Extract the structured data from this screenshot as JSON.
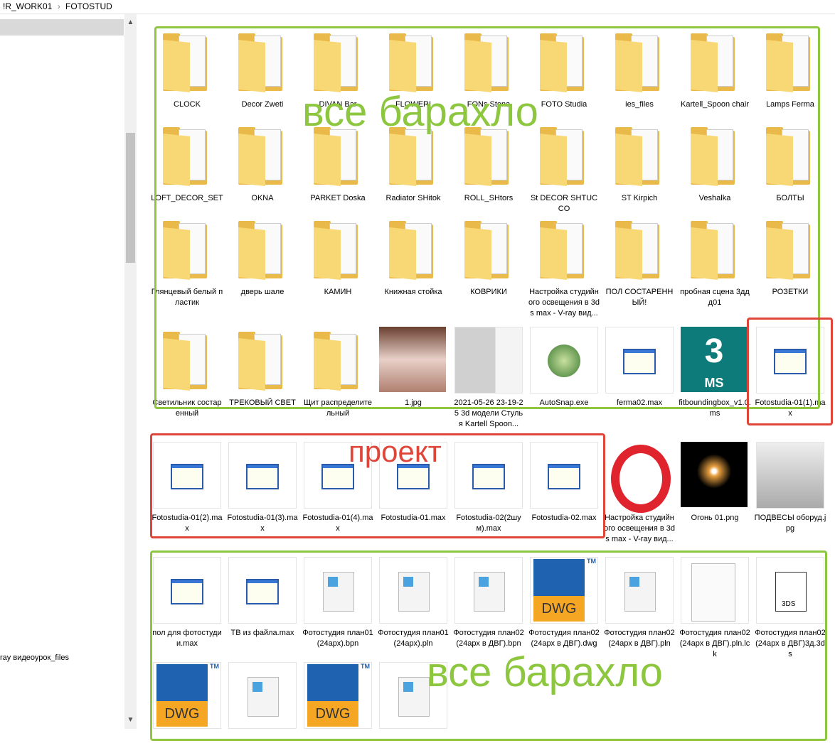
{
  "breadcrumb": [
    "!R_WORK01",
    "FOTOSTUD"
  ],
  "nav": {
    "item": "ray видеоурок_files"
  },
  "colors": {
    "green": "#8dc63f",
    "red": "#e0453a"
  },
  "annotations": {
    "junk": "все барахло",
    "project": "проект",
    "junk2": "все барахло"
  },
  "items": [
    {
      "label": "CLOCK",
      "type": "folder"
    },
    {
      "label": "Decor Zweti",
      "type": "folder"
    },
    {
      "label": "DIVAN Bar",
      "type": "folder"
    },
    {
      "label": "FLOWERI",
      "type": "folder"
    },
    {
      "label": "FONs Stena",
      "type": "folder"
    },
    {
      "label": "FOTO Studia",
      "type": "folder"
    },
    {
      "label": "ies_files",
      "type": "folder"
    },
    {
      "label": "Kartell_Spoon chair",
      "type": "folder"
    },
    {
      "label": "Lamps Ferma",
      "type": "folder"
    },
    {
      "label": "LOFT_DECOR_SET",
      "type": "folder"
    },
    {
      "label": "OKNA",
      "type": "folder"
    },
    {
      "label": "PARKET Doska",
      "type": "folder"
    },
    {
      "label": "Radiator SHitok",
      "type": "folder"
    },
    {
      "label": "ROLL_SHtors",
      "type": "folder"
    },
    {
      "label": "St DECOR SHTUCCO",
      "type": "folder"
    },
    {
      "label": "ST Kirpich",
      "type": "folder"
    },
    {
      "label": "Veshalka",
      "type": "folder"
    },
    {
      "label": "БОЛТЫ",
      "type": "folder"
    },
    {
      "label": "Глянцевый белый пластик",
      "type": "folder"
    },
    {
      "label": "дверь шале",
      "type": "folder"
    },
    {
      "label": "КАМИН",
      "type": "folder"
    },
    {
      "label": "Книжная стойка",
      "type": "folder"
    },
    {
      "label": "КОВРИКИ",
      "type": "folder"
    },
    {
      "label": "Настройка студийного освещения в 3ds max - V-ray вид...",
      "type": "folder"
    },
    {
      "label": "ПОЛ СОСТАРЕННЫЙ!",
      "type": "folder"
    },
    {
      "label": "пробная сцена 3ддд01",
      "type": "folder"
    },
    {
      "label": "РОЗЕТКИ",
      "type": "folder"
    },
    {
      "label": "Светильник состаренный",
      "type": "folder"
    },
    {
      "label": "ТРЕКОВЫЙ СВЕТ",
      "type": "folder"
    },
    {
      "label": "Щит распределительный",
      "type": "folder"
    },
    {
      "label": "1.jpg",
      "type": "photo-room"
    },
    {
      "label": "2021-05-26 23-19-25 3d модели Стулья Kartell Spoon...",
      "type": "photo-chairs"
    },
    {
      "label": "AutoSnap.exe",
      "type": "exe"
    },
    {
      "label": "ferma02.max",
      "type": "max"
    },
    {
      "label": "fitboundingbox_v1.0.ms",
      "type": "ms"
    },
    {
      "label": "Fotostudia-01(1).max",
      "type": "max"
    },
    {
      "label": "Fotostudia-01(2).max",
      "type": "max"
    },
    {
      "label": "Fotostudia-01(3).max",
      "type": "max"
    },
    {
      "label": "Fotostudia-01(4).max",
      "type": "max"
    },
    {
      "label": "Fotostudia-01.max",
      "type": "max"
    },
    {
      "label": "Fotostudia-02(2шум).max",
      "type": "max"
    },
    {
      "label": "Fotostudia-02.max",
      "type": "max"
    },
    {
      "label": "Настройка студийного освещения в 3ds max - V-ray вид...",
      "type": "opera"
    },
    {
      "label": "Огонь 01.png",
      "type": "photo-candle"
    },
    {
      "label": "ПОДВЕСЫ оборуд.jpg",
      "type": "photo-studio"
    },
    {
      "label": "пол для фотостудии.max",
      "type": "max"
    },
    {
      "label": "ТВ из файла.max",
      "type": "max"
    },
    {
      "label": "Фотостудия план01(24арх).bpn",
      "type": "pln"
    },
    {
      "label": "Фотостудия план01(24арх).pln",
      "type": "pln"
    },
    {
      "label": "Фотостудия план02(24арх в ДВГ).bpn",
      "type": "pln"
    },
    {
      "label": "Фотостудия план02(24арх в ДВГ).dwg",
      "type": "dwg"
    },
    {
      "label": "Фотостудия план02(24арх в ДВГ).pln",
      "type": "pln"
    },
    {
      "label": "Фотостудия план02(24арх в ДВГ).pln.lck",
      "type": "blank"
    },
    {
      "label": "Фотостудия план02(24арх в ДВГ)3д.3ds",
      "type": "3ds"
    },
    {
      "label": "",
      "type": "dwg"
    },
    {
      "label": "",
      "type": "pln"
    },
    {
      "label": "",
      "type": "dwg"
    },
    {
      "label": "",
      "type": "pln"
    }
  ]
}
